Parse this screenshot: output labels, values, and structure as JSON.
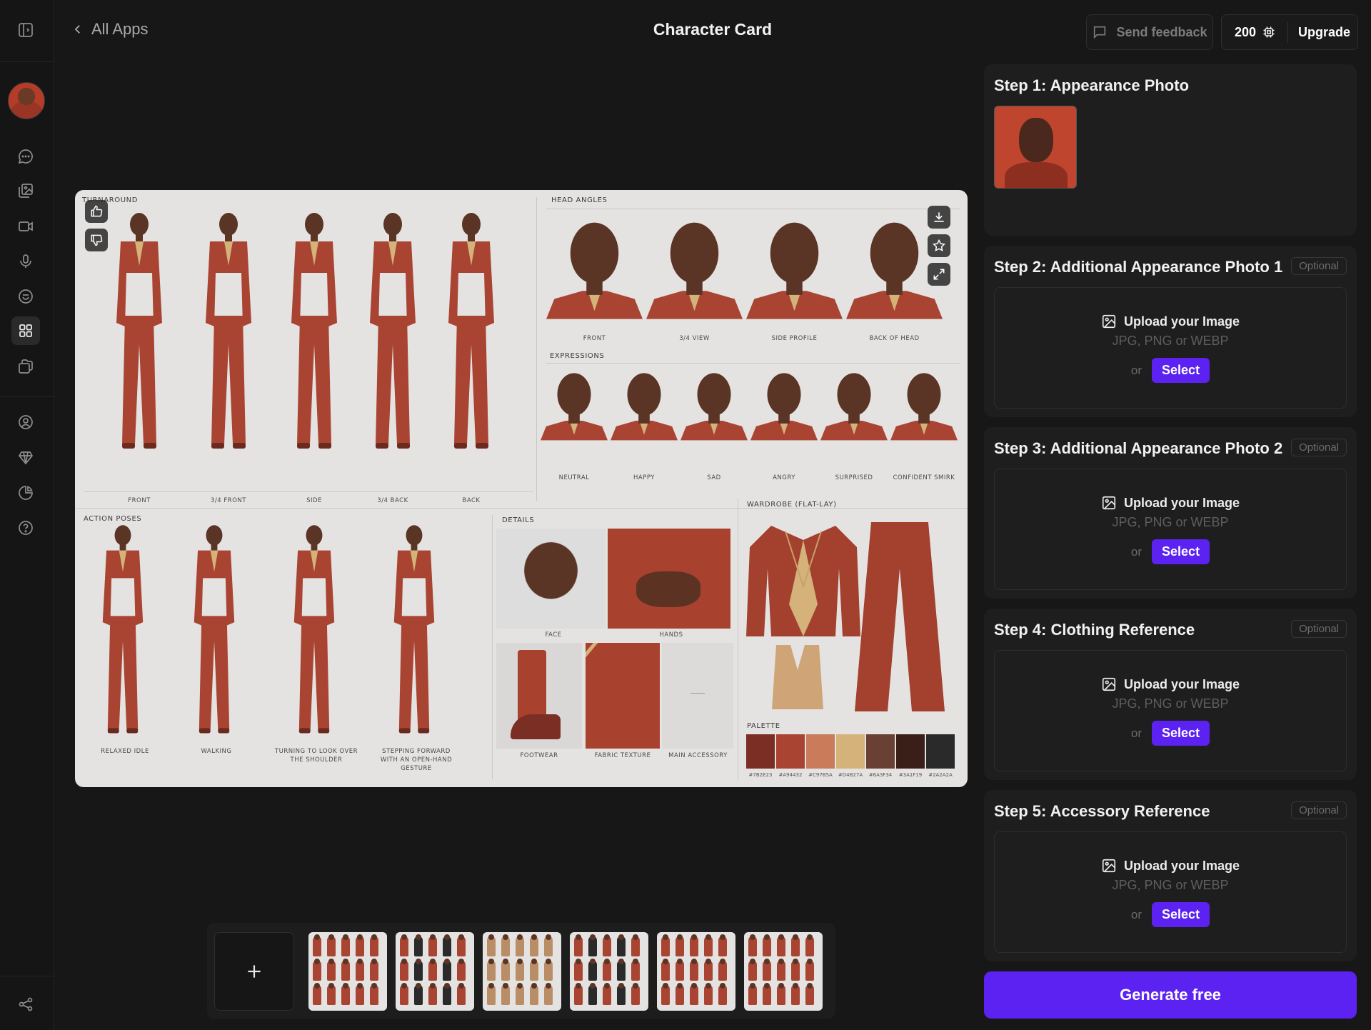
{
  "header": {
    "back_label": "All Apps",
    "title": "Character Card",
    "feedback_label": "Send feedback",
    "credits": "200",
    "upgrade_label": "Upgrade"
  },
  "sheet": {
    "sections": {
      "turnaround": "TURNAROUND",
      "head_angles": "HEAD ANGLES",
      "expressions": "EXPRESSIONS",
      "action_poses": "ACTION POSES",
      "details": "DETAILS",
      "wardrobe": "WARDROBE (FLAT-LAY)",
      "palette": "PALETTE"
    },
    "turnaround_labels": [
      "FRONT",
      "3/4 FRONT",
      "SIDE",
      "3/4 BACK",
      "BACK"
    ],
    "head_angle_labels": [
      "FRONT",
      "3/4 VIEW",
      "SIDE PROFILE",
      "BACK OF HEAD"
    ],
    "expression_labels": [
      "NEUTRAL",
      "HAPPY",
      "SAD",
      "ANGRY",
      "SURPRISED",
      "CONFIDENT SMIRK"
    ],
    "action_labels": [
      "RELAXED IDLE",
      "WALKING",
      "TURNING TO LOOK OVER THE SHOULDER",
      "STEPPING FORWARD WITH AN OPEN-HAND GESTURE"
    ],
    "detail_labels": [
      "FACE",
      "HANDS",
      "FOOTWEAR",
      "FABRIC TEXTURE",
      "MAIN ACCESSORY"
    ],
    "palette": [
      "#7B2E23",
      "#A94432",
      "#C97B5A",
      "#D4B27A",
      "#6A3F34",
      "#3A1F19",
      "#2A2A2A"
    ],
    "palette_labels": [
      "#7B2E23",
      "#A94432",
      "#C97B5A",
      "#D4B27A",
      "#6A3F34",
      "#3A1F19",
      "#2A2A2A"
    ]
  },
  "steps": [
    {
      "title": "Step 1: Appearance Photo",
      "optional": ""
    },
    {
      "title": "Step 2: Additional Appearance Photo 1",
      "optional": "Optional"
    },
    {
      "title": "Step 3: Additional Appearance Photo 2",
      "optional": "Optional"
    },
    {
      "title": "Step 4: Clothing Reference",
      "optional": "Optional"
    },
    {
      "title": "Step 5: Accessory Reference",
      "optional": "Optional"
    }
  ],
  "upload": {
    "label": "Upload your Image",
    "formats": "JPG, PNG or WEBP",
    "or": "or",
    "select": "Select"
  },
  "generate_label": "Generate free",
  "colors": {
    "accent": "#5B22F2",
    "suit": "#A94432",
    "background": "#171717"
  },
  "icons": [
    "sidebar-toggle-icon",
    "chat-icon",
    "images-icon",
    "video-icon",
    "mic-icon",
    "smile-icon",
    "apps-grid-icon",
    "folder-icon",
    "user-circle-icon",
    "gem-icon",
    "pie-chart-icon",
    "help-icon",
    "share-icon"
  ]
}
